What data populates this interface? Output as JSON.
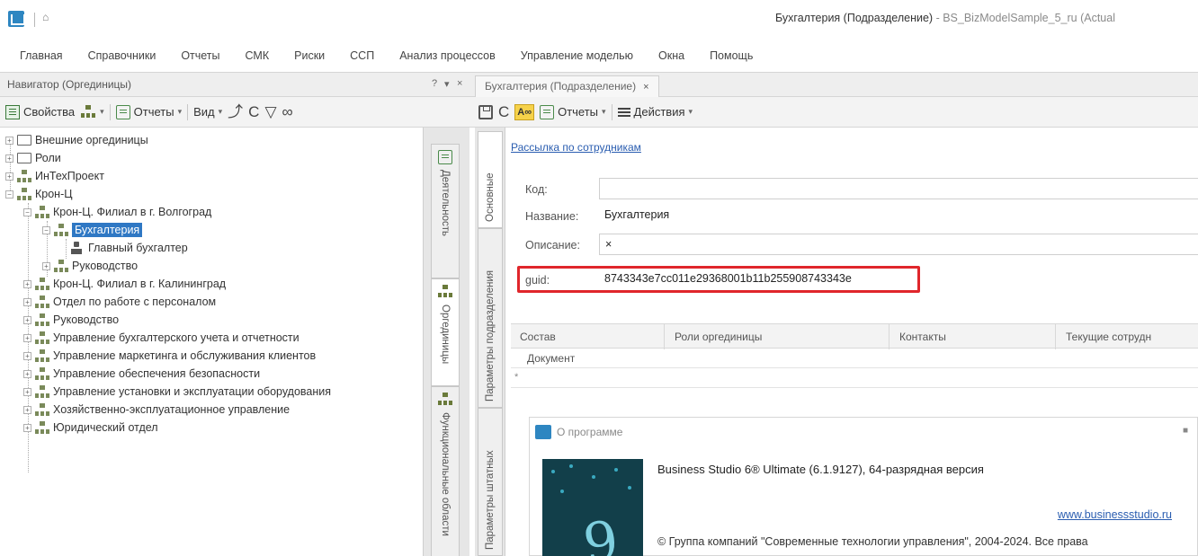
{
  "title": {
    "quick_glyph": "⌂",
    "doc": "Бухгалтерия (Подразделение)",
    "sep": " - ",
    "model": "BS_BizModelSample_5_ru (Actual"
  },
  "menu": [
    "Главная",
    "Справочники",
    "Отчеты",
    "СМК",
    "Риски",
    "ССП",
    "Анализ процессов",
    "Управление моделью",
    "Окна",
    "Помощь"
  ],
  "navigator": {
    "title": "Навигатор (Оргединицы)",
    "controls": [
      "?",
      "▾",
      "×"
    ],
    "toolbar": {
      "props": "Свойства",
      "reports": "Отчеты",
      "view": "Вид",
      "icons": [
        "⤴",
        "C",
        "▽",
        "∞"
      ]
    },
    "tree": [
      "Внешние оргединицы",
      "Роли",
      "ИнТехПроект",
      "Крон-Ц",
      "Крон-Ц. Филиал в г. Волгоград",
      "Бухгалтерия",
      "Главный бухгалтер",
      "Руководство",
      "Крон-Ц. Филиал в г. Калининград",
      "Отдел по работе с персоналом",
      "Руководство",
      "Управление бухгалтерского учета и отчетности",
      "Управление маркетинга и обслуживания клиентов",
      "Управление обеспечения безопасности",
      "Управление установки и эксплуатации оборудования",
      "Хозяйственно-эксплуатационное управление",
      "Юридический отдел"
    ],
    "side_tabs": [
      "Деятельность",
      "Оргединицы",
      "Функциональные области"
    ]
  },
  "document": {
    "tab_label": "Бухгалтерия (Подразделение)",
    "tab_close": "×",
    "toolbar": {
      "az": "A∞",
      "reports": "Отчеты",
      "actions": "Действия"
    },
    "side_tabs": [
      "Основные",
      "Параметры подразделения",
      "Параметры штатных"
    ],
    "link": "Рассылка по сотрудникам",
    "fields": {
      "code_label": "Код:",
      "code_value": "",
      "name_label": "Название:",
      "name_value": "Бухгалтерия",
      "desc_label": "Описание:",
      "desc_value": "×",
      "guid_label": "guid:",
      "guid_value": "8743343e7cc011e29368001b11b255908743343e"
    },
    "grid": {
      "columns": [
        "Состав",
        "Роли оргединицы",
        "Контакты",
        "Текущие сотрудн"
      ],
      "subheader": "Документ",
      "new_row_marker": "*"
    }
  },
  "about": {
    "title": "О программе",
    "close": "■",
    "image_glyph": "9",
    "product": "Business Studio 6® Ultimate  (6.1.9127), 64-разрядная версия",
    "url": "www.businessstudio.ru",
    "copyright": "© Группа компаний \"Современные технологии управления\", 2004-2024. Все права"
  },
  "colors": {
    "selection": "#2f78c4",
    "highlight_frame": "#e0262b",
    "link": "#2a5db0",
    "brand": "#2e86c1"
  }
}
